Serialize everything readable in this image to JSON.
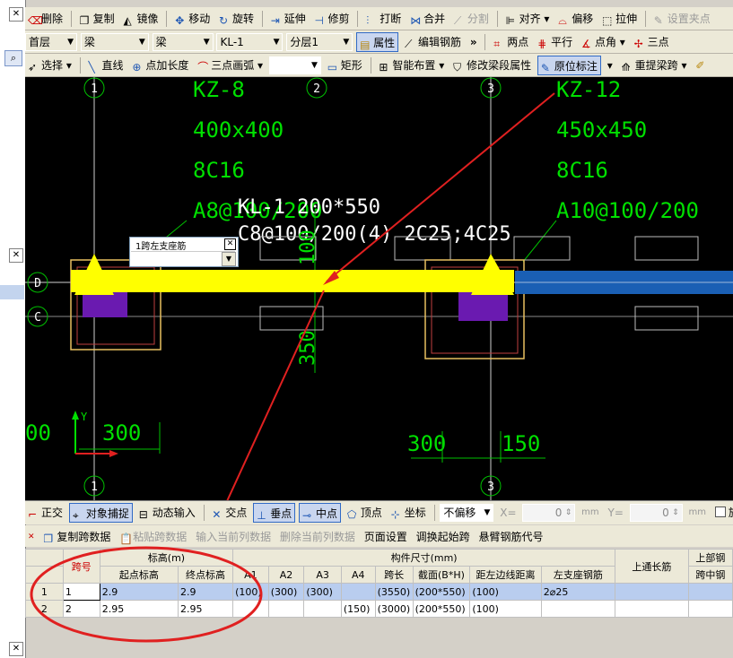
{
  "toolbar1": {
    "delete": "删除",
    "copy": "复制",
    "mirror": "镜像",
    "move": "移动",
    "rotate": "旋转",
    "extend": "延伸",
    "trim": "修剪",
    "break": "打断",
    "merge": "合并",
    "split": "分割",
    "align": "对齐",
    "offset": "偏移",
    "stretch": "拉伸",
    "setpoint": "设置夹点"
  },
  "toolbar2": {
    "floor": "首层",
    "type1": "梁",
    "type2": "梁",
    "element": "KL-1",
    "layer": "分层1",
    "properties": "属性",
    "edit_rebar": "编辑钢筋",
    "two_points": "两点",
    "parallel": "平行",
    "point_angle": "点角",
    "three_point": "三点"
  },
  "toolbar3": {
    "select": "选择",
    "line": "直线",
    "point_length": "点加长度",
    "arc3": "三点画弧",
    "rect": "矩形",
    "smart_layout": "智能布置",
    "modify_span": "修改梁段属性",
    "in_situ": "原位标注",
    "redo_span": "重提梁跨"
  },
  "cad": {
    "axis_labels": [
      "1",
      "2",
      "3",
      "D",
      "C",
      "1",
      "3"
    ],
    "col_left": {
      "name": "KZ-8",
      "size": "400x400",
      "rebar": "8C16",
      "stirrup": "A8@100/200"
    },
    "col_right": {
      "name": "KZ-12",
      "size": "450x450",
      "rebar": "8C16",
      "stirrup": "A10@100/200"
    },
    "beam_label": "KL-1 200*550",
    "beam_rebar": "C8@100/200(4) 2C25;4C25",
    "dim_100": "100",
    "dim_350": "350",
    "dim_left_300": "300",
    "dim_left_00": "00",
    "dim_right_300": "300",
    "dim_right_150": "150",
    "y_axis": "Y",
    "popup_label": "1跨左支座筋"
  },
  "statusbar": {
    "ortho": "正交",
    "snap": "对象捕捉",
    "dyn_input": "动态输入",
    "intersect": "交点",
    "perp": "垂点",
    "mid": "中点",
    "vertex": "顶点",
    "coord": "坐标",
    "offset_mode": "不偏移",
    "x_label": "X=",
    "x_value": "0",
    "mm1": "mm",
    "y_label": "Y=",
    "y_value": "0",
    "mm2": "mm",
    "rotate": "旋转"
  },
  "gridtoolbar": {
    "copy_span": "复制跨数据",
    "paste_span": "粘贴跨数据",
    "input_col": "输入当前列数据",
    "delete_col": "删除当前列数据",
    "page_setup": "页面设置",
    "swap_start": "调换起始跨",
    "cantilever": "悬臂钢筋代号"
  },
  "table": {
    "h_span": "跨号",
    "h_elev": "标高(m)",
    "h_start": "起点标高",
    "h_end": "终点标高",
    "h_size": "构件尺寸(mm)",
    "h_a1": "A1",
    "h_a2": "A2",
    "h_a3": "A3",
    "h_a4": "A4",
    "h_len": "跨长",
    "h_sec": "截面(B*H)",
    "h_dist": "距左边线距离",
    "h_top": "上通长筋",
    "h_upper": "上部钢",
    "h_left": "左支座钢筋",
    "h_mid": "跨中钢",
    "rows": [
      {
        "idx": "1",
        "span": "1",
        "start": "2.9",
        "end": "2.9",
        "a1": "(100)",
        "a2": "(300)",
        "a3": "(300)",
        "a4": "",
        "len": "(3550)",
        "sec": "(200*550)",
        "dist": "(100)",
        "top": "2⌀25",
        "left": "",
        "mid": ""
      },
      {
        "idx": "2",
        "span": "2",
        "start": "2.95",
        "end": "2.95",
        "a1": "",
        "a2": "",
        "a3": "",
        "a4": "(150)",
        "len": "(3000)",
        "sec": "(200*550)",
        "dist": "(100)",
        "top": "",
        "left": "",
        "mid": ""
      }
    ]
  },
  "colors": {
    "beam": "#ffff00",
    "text_green": "#00e000",
    "annotation_red": "#e02020",
    "blue_beam": "#1a5fb4"
  }
}
